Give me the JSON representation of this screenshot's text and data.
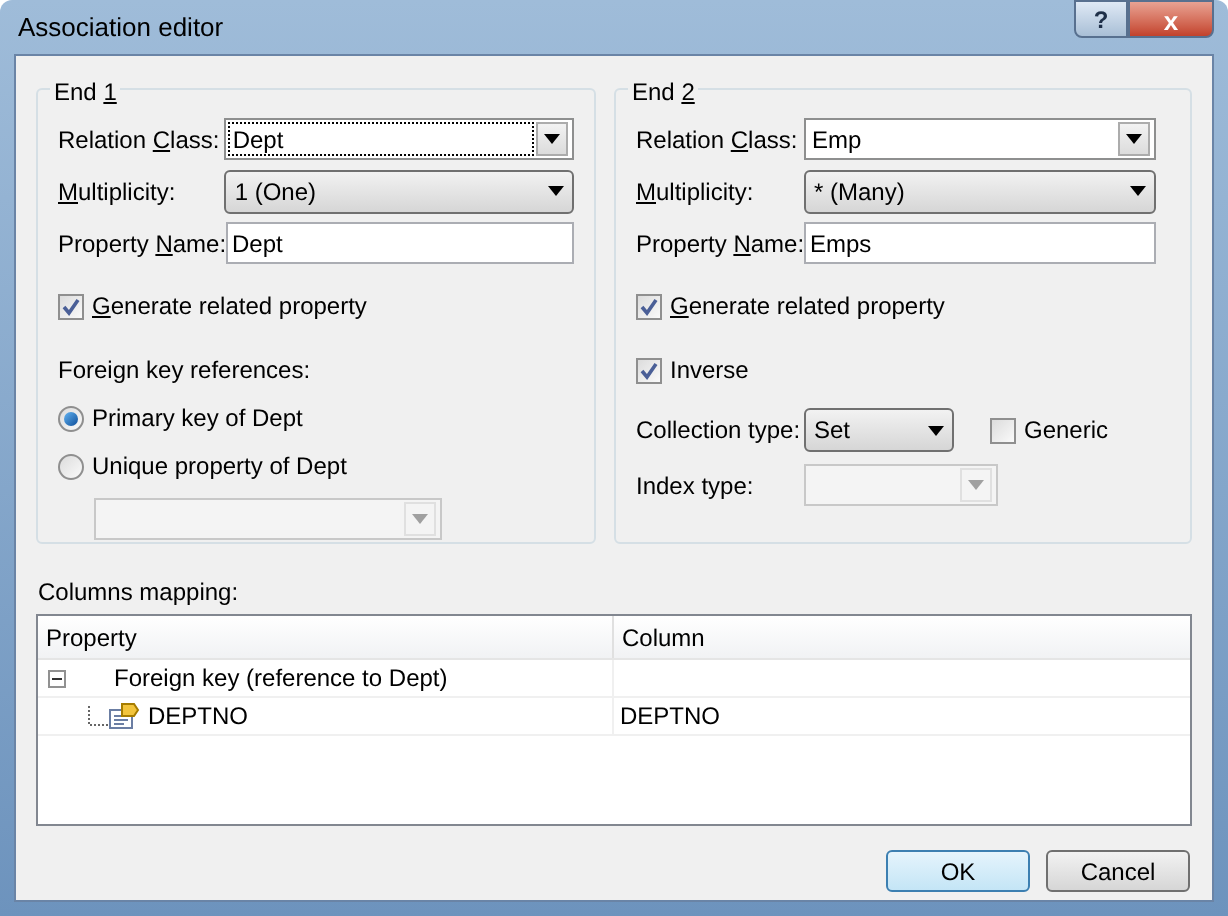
{
  "window": {
    "title": "Association editor",
    "buttons": [
      "?",
      "x"
    ]
  },
  "end1": {
    "legend": {
      "before": "End ",
      "key": "1"
    },
    "relation_class": {
      "label": {
        "before": "Relation ",
        "key": "C",
        "after": "lass:"
      },
      "value": "Dept",
      "focused": true
    },
    "multiplicity": {
      "label": {
        "key": "M",
        "after": "ultiplicity:"
      },
      "value": "1 (One)"
    },
    "property_name": {
      "label": {
        "before": "Property ",
        "key": "N",
        "after": "ame:"
      },
      "value": "Dept"
    },
    "generate": {
      "label": {
        "key": "G",
        "after": "enerate related property"
      },
      "checked": true
    },
    "fk_label": "Foreign key references:",
    "fk_options": [
      {
        "label": "Primary key of Dept",
        "selected": true
      },
      {
        "label": "Unique property of Dept",
        "selected": false
      }
    ],
    "unique_combo": {
      "disabled": true
    }
  },
  "end2": {
    "legend": {
      "before": "End ",
      "key": "2"
    },
    "relation_class": {
      "label": {
        "before": "Relation ",
        "key": "C",
        "after": "lass:"
      },
      "value": "Emp",
      "focused": false
    },
    "multiplicity": {
      "label": {
        "key": "M",
        "after": "ultiplicity:"
      },
      "value": "* (Many)"
    },
    "property_name": {
      "label": {
        "before": "Property ",
        "key": "N",
        "after": "ame:"
      },
      "value": "Emps"
    },
    "generate": {
      "label": {
        "key": "G",
        "after": "enerate related property"
      },
      "checked": true
    },
    "inverse": {
      "label": "Inverse",
      "checked": true
    },
    "collection_type": {
      "label": "Collection type:",
      "value": "Set"
    },
    "generic": {
      "label": "Generic",
      "checked": false
    },
    "index_type": {
      "label": "Index type:",
      "disabled": true
    }
  },
  "mapping": {
    "label": "Columns mapping:",
    "columns": [
      "Property",
      "Column"
    ],
    "rows": [
      {
        "property": "Foreign key (reference to Dept)",
        "expanded": true,
        "children": [
          {
            "property": "DEPTNO",
            "column": "DEPTNO"
          }
        ]
      }
    ]
  },
  "buttons": [
    {
      "label": "OK",
      "default": true
    },
    {
      "label": "Cancel",
      "default": false
    }
  ]
}
